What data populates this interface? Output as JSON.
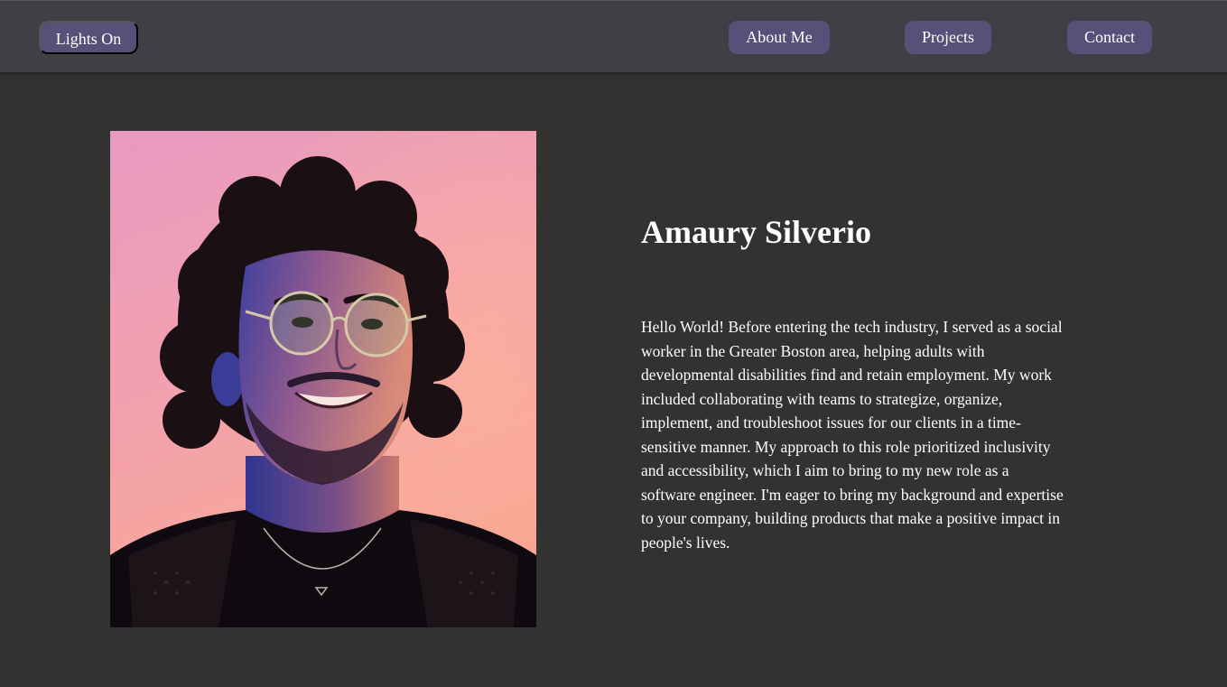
{
  "nav": {
    "theme_toggle_label": "Lights On",
    "links": [
      {
        "label": "About Me"
      },
      {
        "label": "Projects"
      },
      {
        "label": "Contact"
      }
    ]
  },
  "profile": {
    "name": "Amaury Silverio",
    "bio": "Hello World! Before entering the tech industry, I served as a social worker in the Greater Boston area, helping adults with developmental disabilities find and retain employment. My work included collaborating with teams to strategize, organize, implement, and troubleshoot issues for our clients in a time-sensitive manner. My approach to this role prioritized inclusivity and accessibility, which I aim to bring to my new role as a software engineer. I'm eager to bring my background and expertise to your company, building products that make a positive impact in people's lives."
  },
  "colors": {
    "page_background": "#323330",
    "navbar_background": "#3f3f45",
    "button_background": "#575079",
    "text": "#ffffff"
  }
}
